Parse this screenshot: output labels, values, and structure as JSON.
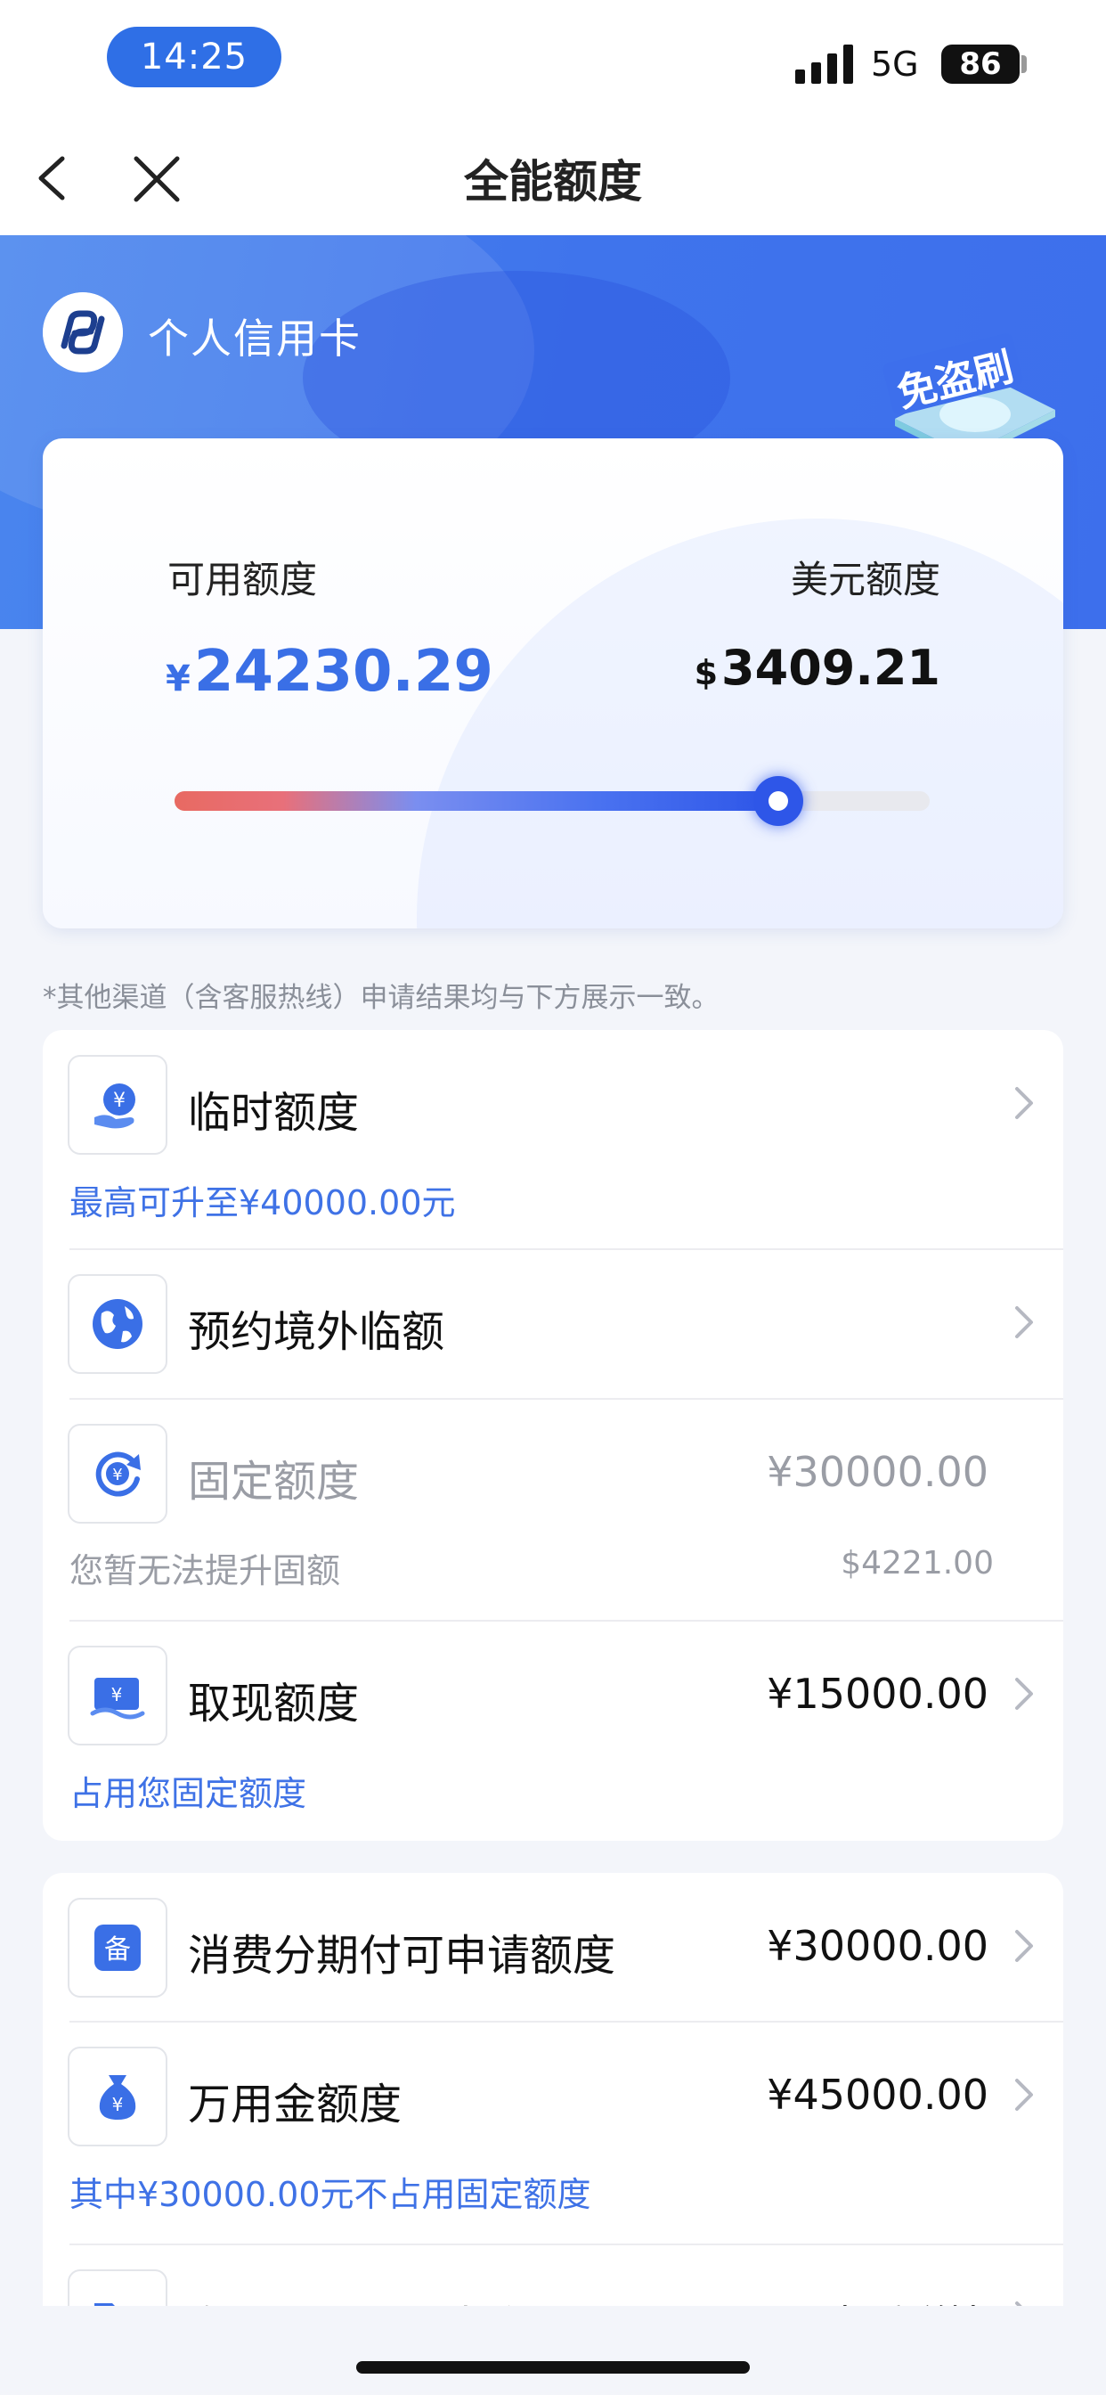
{
  "status_bar": {
    "time": "14:25",
    "network": "5G",
    "battery": "86"
  },
  "nav": {
    "title": "全能额度"
  },
  "card": {
    "name": "个人信用卡",
    "badge_text": "免盗刷"
  },
  "quota": {
    "available_label": "可用额度",
    "available_currency": "¥",
    "available_amount": "24230.29",
    "usd_label": "美元额度",
    "usd_currency": "$",
    "usd_amount": "3409.21",
    "available_ratio": 0.8
  },
  "notice": "*其他渠道（含客服热线）申请结果均与下方展示一致。",
  "group1": {
    "temp": {
      "title": "临时额度",
      "sub": "最高可升至¥40000.00元"
    },
    "overseas": {
      "title": "预约境外临额"
    },
    "fixed": {
      "title": "固定额度",
      "value": "¥30000.00",
      "sub": "您暂无法提升固额",
      "sub_value": "$4221.00"
    },
    "cash": {
      "title": "取现额度",
      "value": "¥15000.00",
      "sub": "占用您固定额度"
    }
  },
  "group2": {
    "installment": {
      "title": "消费分期付可申请额度",
      "value": "¥30000.00"
    },
    "wanyong": {
      "title": "万用金额度",
      "value": "¥45000.00",
      "sub": "其中¥30000.00元不占用固定额度"
    },
    "partial": {
      "title": "专项分期记录查询",
      "value": "查看详情"
    }
  },
  "colors": {
    "accent": "#3a6fe6",
    "hero_blue": "#3f74ec",
    "alert_red": "#e86a62"
  },
  "icons": {
    "temp": "yuan-hand-icon",
    "overseas": "globe-icon",
    "fixed": "yuan-cycle-icon",
    "cash": "yuan-banknote-icon",
    "installment": "bei-badge-icon",
    "wanyong": "money-bag-icon",
    "partial": "folder-icon"
  }
}
